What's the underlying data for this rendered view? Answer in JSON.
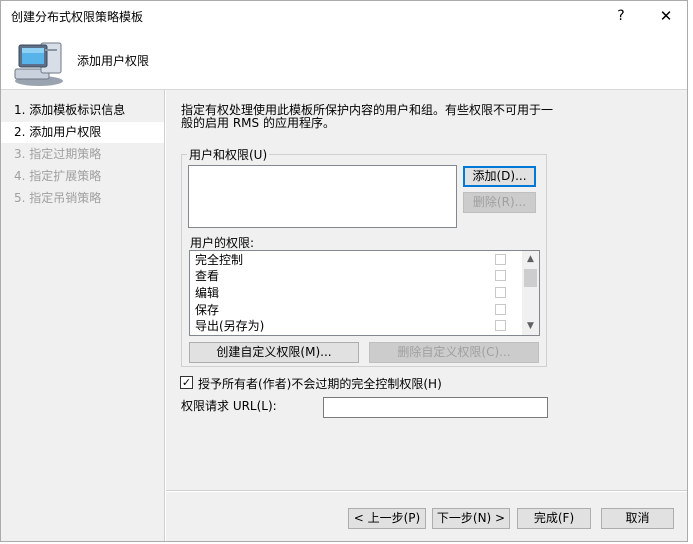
{
  "window": {
    "title": "创建分布式权限策略模板",
    "help_label": "?",
    "close_label": "✕"
  },
  "header": {
    "title": "添加用户权限"
  },
  "sidebar": {
    "items": [
      {
        "label": "1.  添加模板标识信息",
        "state": "normal"
      },
      {
        "label": "2.  添加用户权限",
        "state": "active"
      },
      {
        "label": "3.  指定过期策略",
        "state": "disabled"
      },
      {
        "label": "4.  指定扩展策略",
        "state": "disabled"
      },
      {
        "label": "5.  指定吊销策略",
        "state": "disabled"
      }
    ]
  },
  "main": {
    "description": "指定有权处理使用此模板所保护内容的用户和组。有些权限不可用于一般的启用 RMS 的应用程序。",
    "users_group_label": "用户和权限(U)",
    "add_button": "添加(D)...",
    "remove_button": "删除(R)...",
    "user_rights_label": "用户的权限:",
    "permissions": [
      {
        "label": "完全控制",
        "checked": false
      },
      {
        "label": "查看",
        "checked": false
      },
      {
        "label": "编辑",
        "checked": false
      },
      {
        "label": "保存",
        "checked": false
      },
      {
        "label": "导出(另存为)",
        "checked": false
      }
    ],
    "create_custom_button": "创建自定义权限(M)...",
    "delete_custom_button": "删除自定义权限(C)...",
    "grant_owner_label": "授予所有者(作者)不会过期的完全控制权限(H)",
    "grant_owner_checked": true,
    "rights_url_label": "权限请求 URL(L):",
    "rights_url_value": ""
  },
  "footer": {
    "back_button": "< 上一步(P)",
    "next_button": "下一步(N) >",
    "finish_button": "完成(F)",
    "cancel_button": "取消"
  },
  "icons": {
    "header_icon": "computer-monitor-icon",
    "scroll_up": "chevron-up-icon",
    "scroll_down": "chevron-down-icon",
    "check": "checkmark-icon"
  },
  "colors": {
    "accent": "#0078d7",
    "disabled_text": "#a0a0a0",
    "background": "#f0f0f0"
  }
}
